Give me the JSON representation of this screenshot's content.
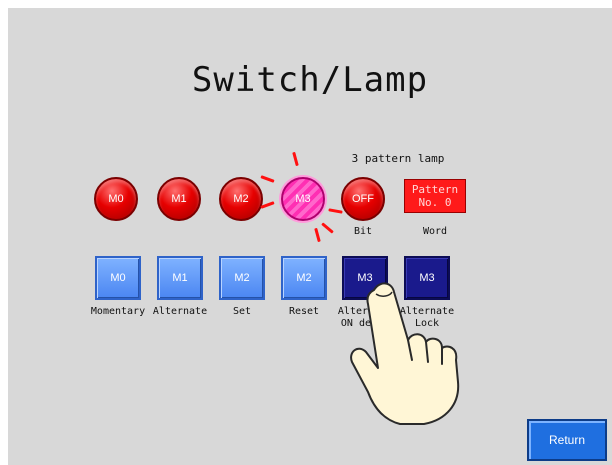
{
  "screen": {
    "title": "Switch/Lamp",
    "lamp_group_caption": "3 pattern lamp"
  },
  "lamps": [
    {
      "label": "M0",
      "state": "off"
    },
    {
      "label": "M1",
      "state": "off"
    },
    {
      "label": "M2",
      "state": "off"
    },
    {
      "label": "M3",
      "state": "on-blinking"
    },
    {
      "label": "OFF",
      "caption": "Bit",
      "state": "off"
    }
  ],
  "word_lamp": {
    "line1": "Pattern",
    "line2": "No. 0",
    "caption": "Word"
  },
  "switches": [
    {
      "label": "M0",
      "caption": "Momentary"
    },
    {
      "label": "M1",
      "caption": "Alternate"
    },
    {
      "label": "M2",
      "caption": "Set"
    },
    {
      "label": "M2",
      "caption": "Reset"
    },
    {
      "label": "M3",
      "caption_line1": "Alternate",
      "caption_line2": "ON delay"
    },
    {
      "label": "M3",
      "caption_line1": "Alternate",
      "caption_line2": "Lock"
    }
  ],
  "return_button": {
    "label": "Return"
  },
  "colors": {
    "background": "#d8d8d8",
    "lamp_red": "#e60000",
    "lamp_on": "#ff2fb3",
    "switch_blue": "#4b86f2",
    "switch_dark": "#1a1a8c",
    "return_blue": "#1f6fe0"
  },
  "icons": {
    "pointer": "pointing-hand-icon"
  }
}
